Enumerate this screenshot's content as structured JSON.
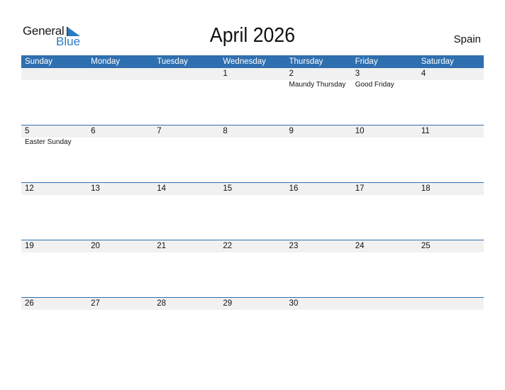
{
  "logo": {
    "word1": "General",
    "word2": "Blue"
  },
  "title": "April 2026",
  "country": "Spain",
  "colors": {
    "header": "#2e6fb0",
    "brand_blue": "#2a7bc4",
    "date_strip": "#f1f1f1"
  },
  "weekdays": [
    "Sunday",
    "Monday",
    "Tuesday",
    "Wednesday",
    "Thursday",
    "Friday",
    "Saturday"
  ],
  "weeks": [
    [
      {
        "d": "",
        "e": ""
      },
      {
        "d": "",
        "e": ""
      },
      {
        "d": "",
        "e": ""
      },
      {
        "d": "1",
        "e": ""
      },
      {
        "d": "2",
        "e": "Maundy Thursday"
      },
      {
        "d": "3",
        "e": "Good Friday"
      },
      {
        "d": "4",
        "e": ""
      }
    ],
    [
      {
        "d": "5",
        "e": "Easter Sunday"
      },
      {
        "d": "6",
        "e": ""
      },
      {
        "d": "7",
        "e": ""
      },
      {
        "d": "8",
        "e": ""
      },
      {
        "d": "9",
        "e": ""
      },
      {
        "d": "10",
        "e": ""
      },
      {
        "d": "11",
        "e": ""
      }
    ],
    [
      {
        "d": "12",
        "e": ""
      },
      {
        "d": "13",
        "e": ""
      },
      {
        "d": "14",
        "e": ""
      },
      {
        "d": "15",
        "e": ""
      },
      {
        "d": "16",
        "e": ""
      },
      {
        "d": "17",
        "e": ""
      },
      {
        "d": "18",
        "e": ""
      }
    ],
    [
      {
        "d": "19",
        "e": ""
      },
      {
        "d": "20",
        "e": ""
      },
      {
        "d": "21",
        "e": ""
      },
      {
        "d": "22",
        "e": ""
      },
      {
        "d": "23",
        "e": ""
      },
      {
        "d": "24",
        "e": ""
      },
      {
        "d": "25",
        "e": ""
      }
    ],
    [
      {
        "d": "26",
        "e": ""
      },
      {
        "d": "27",
        "e": ""
      },
      {
        "d": "28",
        "e": ""
      },
      {
        "d": "29",
        "e": ""
      },
      {
        "d": "30",
        "e": ""
      },
      {
        "d": "",
        "e": ""
      },
      {
        "d": "",
        "e": ""
      }
    ]
  ]
}
